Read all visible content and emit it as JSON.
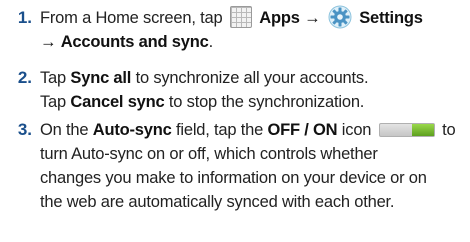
{
  "steps": [
    {
      "number": "1.",
      "from_text": "From a Home screen, tap",
      "apps_label": "Apps",
      "arrow1": "→",
      "settings_label": "Settings",
      "arrow2": "→",
      "accounts_label": "Accounts and sync",
      "period": ".",
      "apps_icon": "apps-grid-icon",
      "settings_icon": "gear-icon"
    },
    {
      "number": "2.",
      "tap1": "Tap",
      "sync_all": "Sync all",
      "sync_all_rest": "to synchronize all your accounts.",
      "tap2": "Tap",
      "cancel_sync": "Cancel sync",
      "cancel_rest": "to stop the synchronization."
    },
    {
      "number": "3.",
      "on_the": "On the",
      "auto_sync": "Auto-sync",
      "field_tap": "field, tap the",
      "off_on": "OFF / ON",
      "icon_word": "icon",
      "to": "to",
      "toggle_icon": "toggle-switch-icon",
      "toggle_state": "on",
      "lines": [
        "turn Auto-sync on or off, which controls whether",
        "changes you make to information on your device or on",
        "the web are automatically synced with each other."
      ]
    }
  ],
  "colors": {
    "number": "#1a4f8b",
    "toggle_on": "#6cb52c"
  }
}
